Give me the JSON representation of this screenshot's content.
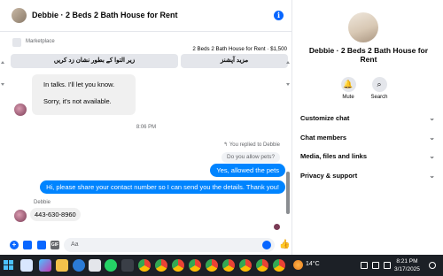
{
  "header": {
    "title": "Debbie · 2 Beds 2 Bath House for Rent",
    "info_icon": "info-icon"
  },
  "marketplace": {
    "label": "Marketplace",
    "listing": "2 Beds 2 Bath House for Rent · $1,500",
    "button_mark_unavailable": "زیر التوا کے بطور نشان زد کریں",
    "button_more_options": "مزید آپشنز"
  },
  "messages": {
    "in1": "In talks. I'll let you know.",
    "in2": "Sorry, it's not available.",
    "timestamp": "8:06 PM",
    "replied_label": "You replied to Debbie",
    "quoted": "Do you allow pets?",
    "out1": "Yes, allowed the pets",
    "out2": "Hi, please share your contact number so I can send you the details. Thank you!",
    "sender": "Debbie",
    "in3": "443-630-8960"
  },
  "composer": {
    "placeholder": "Aa"
  },
  "side_panel": {
    "title": "Debbie · 2 Beds 2 Bath House for Rent",
    "mute_label": "Mute",
    "search_label": "Search",
    "rows": [
      "Customize chat",
      "Chat members",
      "Media, files and links",
      "Privacy & support"
    ]
  },
  "taskbar": {
    "weather": "14°C",
    "time": "8:21 PM",
    "date": "3/17/2025"
  },
  "colors": {
    "accent": "#0866ff",
    "outgoing_bubble": "#0084ff",
    "incoming_bubble": "#f0f0f0",
    "taskbar": "#1c2026"
  }
}
